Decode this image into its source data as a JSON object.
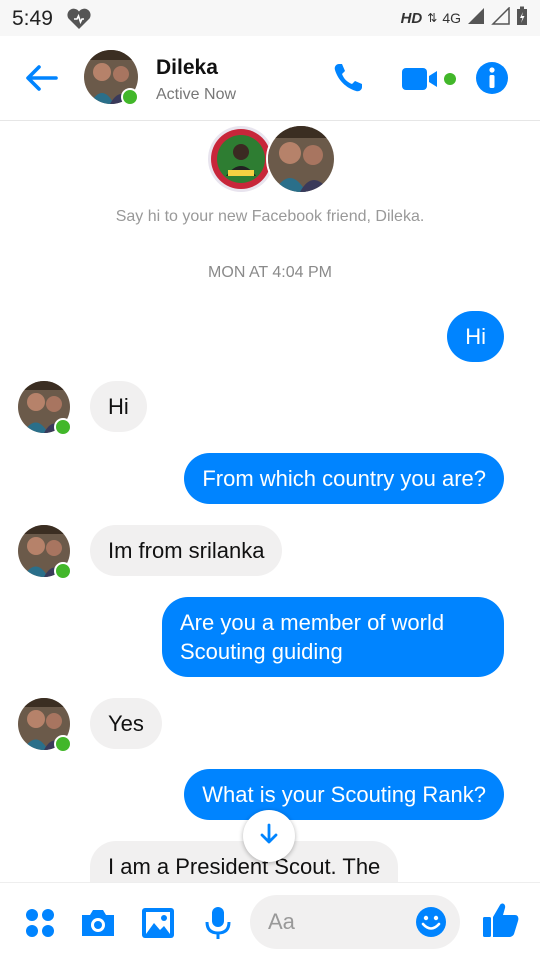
{
  "status_bar": {
    "time": "5:49",
    "hd": "HD",
    "network": "4G"
  },
  "header": {
    "contact_name": "Dileka",
    "contact_status": "Active Now"
  },
  "conversation": {
    "intro_text": "Say hi to your new Facebook friend, Dileka.",
    "timestamp": "MON AT 4:04 PM",
    "messages": [
      {
        "from": "me",
        "text": "Hi"
      },
      {
        "from": "them",
        "text": "Hi"
      },
      {
        "from": "me",
        "text": "From which country you are?"
      },
      {
        "from": "them",
        "text": "Im from srilanka"
      },
      {
        "from": "me",
        "line1": "Are you a member of world",
        "line2": "Scouting guiding"
      },
      {
        "from": "them",
        "text": "Yes"
      },
      {
        "from": "me",
        "text": "What is your Scouting Rank?"
      },
      {
        "from": "them",
        "text": "I am a President Scout. The"
      }
    ]
  },
  "composer": {
    "placeholder": "Aa"
  },
  "colors": {
    "accent": "#0084ff",
    "online": "#42b72a",
    "incoming_bubble": "#f1f0f0"
  },
  "icons": [
    "back-arrow-icon",
    "phone-icon",
    "video-camera-icon",
    "info-icon",
    "arrow-down-icon",
    "apps-grid-icon",
    "camera-icon",
    "gallery-icon",
    "microphone-icon",
    "emoji-icon",
    "thumbs-up-icon",
    "heart-icon"
  ]
}
